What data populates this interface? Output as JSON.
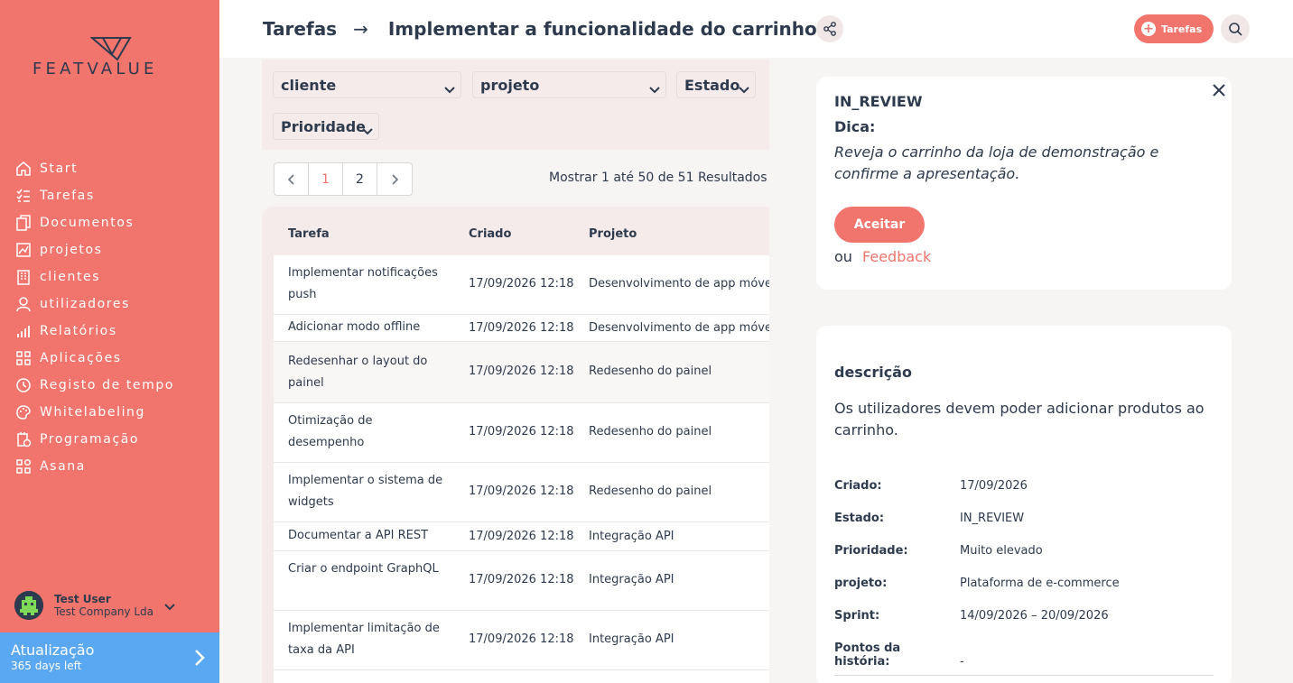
{
  "app": {
    "logo_text": "FEATVALUE"
  },
  "sidebar": {
    "items": [
      {
        "label": "Start",
        "icon": "home-icon"
      },
      {
        "label": "Tarefas",
        "icon": "tasks-icon"
      },
      {
        "label": "Documentos",
        "icon": "documents-icon"
      },
      {
        "label": "projetos",
        "icon": "projects-icon"
      },
      {
        "label": "clientes",
        "icon": "clients-icon"
      },
      {
        "label": "utilizadores",
        "icon": "users-icon"
      },
      {
        "label": "Relatórios",
        "icon": "reports-icon"
      },
      {
        "label": "Aplicações",
        "icon": "apps-icon"
      },
      {
        "label": "Registo de tempo",
        "icon": "time-icon"
      },
      {
        "label": "Whitelabeling",
        "icon": "whitelabel-icon"
      },
      {
        "label": "Programação",
        "icon": "schedule-icon"
      },
      {
        "label": "Asana",
        "icon": "asana-icon"
      }
    ],
    "user": {
      "name": "Test User",
      "company": "Test Company Lda"
    },
    "update": {
      "title": "Atualização",
      "subtitle": "365 days left"
    }
  },
  "header": {
    "breadcrumb_root": "Tarefas",
    "breadcrumb_arrow": "→",
    "breadcrumb_current": "Implementar a funcionalidade do carrinho",
    "tasks_button": "Tarefas"
  },
  "filters": {
    "client": "cliente",
    "project": "projeto",
    "state": "Estado",
    "priority": "Prioridade"
  },
  "pagination": {
    "pages": [
      "1",
      "2"
    ],
    "current": "1",
    "results_text": "Mostrar 1 até 50 de 51 Resultados"
  },
  "table": {
    "headers": {
      "task": "Tarefa",
      "created": "Criado",
      "project": "Projeto"
    },
    "rows": [
      {
        "task": "Implementar notificações push",
        "created": "17/09/2026 12:18",
        "project": "Desenvolvimento de app móvel"
      },
      {
        "task": "Adicionar modo offline",
        "created": "17/09/2026 12:18",
        "project": "Desenvolvimento de app móvel"
      },
      {
        "task": "Redesenhar o layout do painel",
        "created": "17/09/2026 12:18",
        "project": "Redesenho do painel"
      },
      {
        "task": "Otimização de desempenho",
        "created": "17/09/2026 12:18",
        "project": "Redesenho do painel"
      },
      {
        "task": "Implementar o sistema de widgets",
        "created": "17/09/2026 12:18",
        "project": "Redesenho do painel"
      },
      {
        "task": "Documentar a API REST",
        "created": "17/09/2026 12:18",
        "project": "Integração API"
      },
      {
        "task": "Criar o endpoint GraphQL",
        "created": "17/09/2026 12:18",
        "project": "Integração API"
      },
      {
        "task": "Implementar limitação de taxa da API",
        "created": "17/09/2026 12:18",
        "project": "Integração API"
      }
    ]
  },
  "hint": {
    "status": "IN_REVIEW",
    "label": "Dica:",
    "text": "Reveja o carrinho da loja de demonstração e confirme a apresentação.",
    "accept": "Aceitar",
    "or": "ou",
    "feedback": "Feedback"
  },
  "description": {
    "title": "descrição",
    "text": "Os utilizadores devem poder adicionar produtos ao carrinho.",
    "meta": [
      {
        "key": "Criado:",
        "value": "17/09/2026"
      },
      {
        "key": "Estado:",
        "value": "IN_REVIEW"
      },
      {
        "key": "Prioridade:",
        "value": "Muito elevado"
      },
      {
        "key": "projeto:",
        "value": "Plataforma de e-commerce"
      },
      {
        "key": "Sprint:",
        "value": "14/09/2026 – 20/09/2026"
      },
      {
        "key": "Pontos da história:",
        "value": "-"
      }
    ]
  },
  "colors": {
    "accent": "#f2756d",
    "text": "#2e3a4d",
    "update": "#5ba8f2"
  }
}
